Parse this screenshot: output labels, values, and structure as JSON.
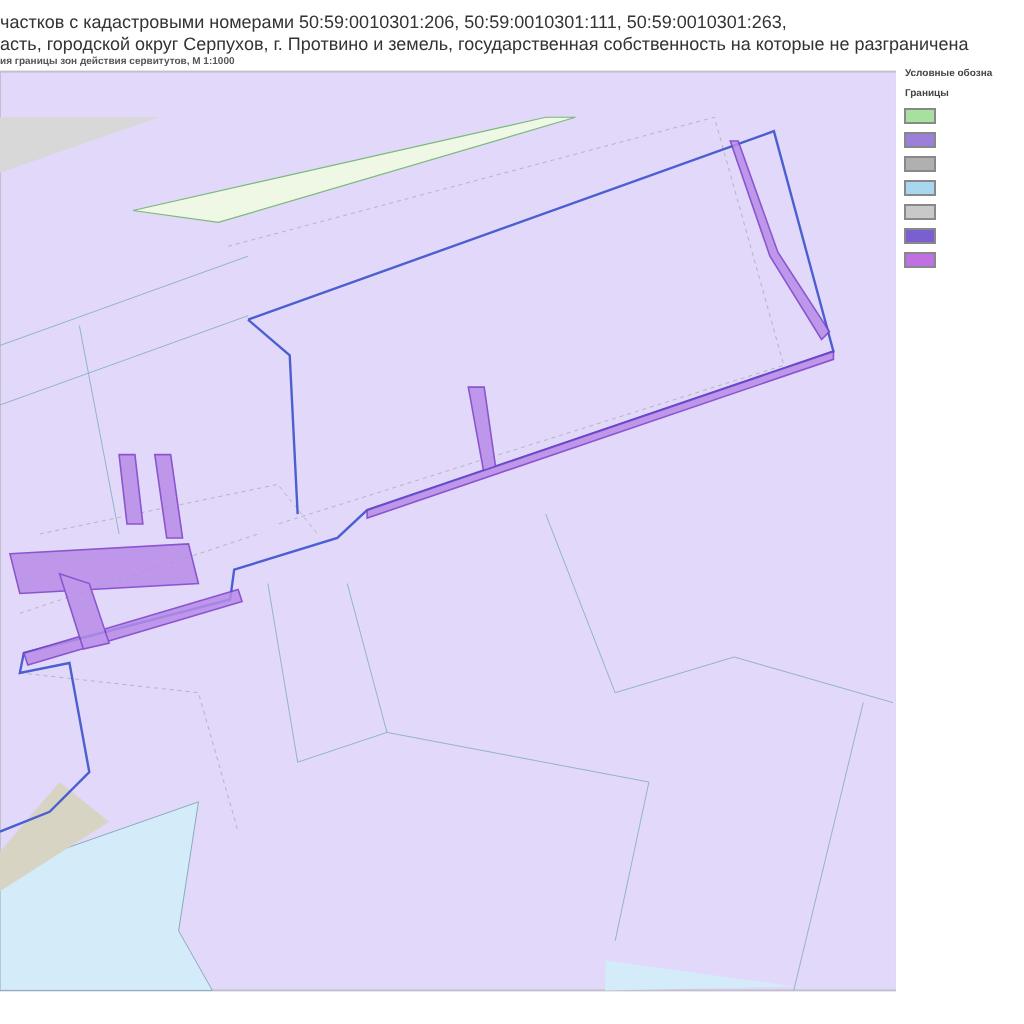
{
  "header": {
    "lines": [
      "частков с кадастровыми номерами 50:59:0010301:206, 50:59:0010301:111, 50:59:0010301:263,",
      "асть, городской округ Серпухов, г. Протвино и земель, государственная собственность на которые не разграничена",
      "ия границы зон действия сервитутов, М 1:1000"
    ]
  },
  "legend": {
    "title": "Условные обозна",
    "section": "Границы",
    "items": [
      {
        "color": "#a8e0a0"
      },
      {
        "color": "#9b7fd8"
      },
      {
        "color": "#b0b0b0"
      },
      {
        "color": "#a8d8f0"
      },
      {
        "color": "#c8c8c8"
      },
      {
        "color": "#7a5fd0"
      },
      {
        "color": "#c070e0"
      }
    ]
  }
}
